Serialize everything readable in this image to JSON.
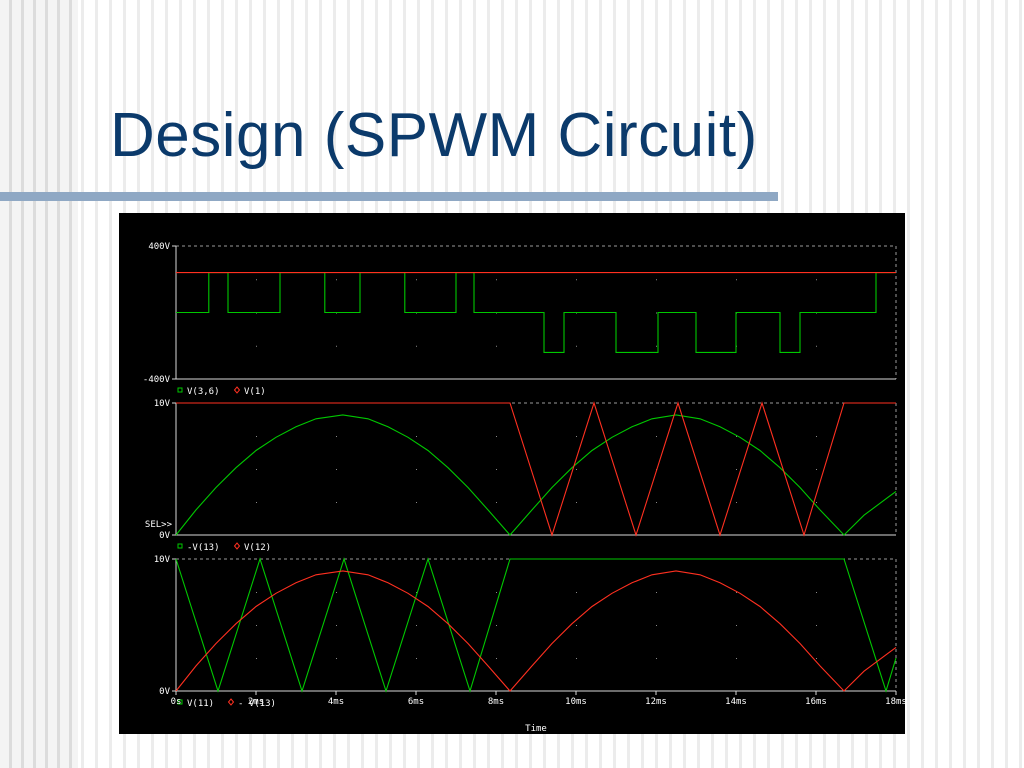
{
  "slide": {
    "title": "Design (SPWM Circuit)"
  },
  "chart_data": {
    "type": "line",
    "x_axis": {
      "label": "Time",
      "range_ms": [
        0,
        18
      ],
      "ticks": [
        "0s",
        "2ms",
        "4ms",
        "6ms",
        "8ms",
        "10ms",
        "12ms",
        "14ms",
        "16ms",
        "18ms"
      ]
    },
    "panels": [
      {
        "name": "output-voltage",
        "ylim": [
          -400,
          400
        ],
        "y_tick_labels": [
          "400V",
          "-400V"
        ],
        "legend": [
          {
            "label": "V(3,6)",
            "marker": "□",
            "color": "#00c800"
          },
          {
            "label": "V(1)",
            "marker": "◇",
            "color": "#ff3020"
          }
        ],
        "series": [
          {
            "name": "V(3,6)",
            "color": "#00c800",
            "kind": "step",
            "points": [
              [
                0,
                0
              ],
              [
                0.82,
                0
              ],
              [
                0.82,
                240
              ],
              [
                1.3,
                240
              ],
              [
                1.3,
                0
              ],
              [
                2.6,
                0
              ],
              [
                2.6,
                240
              ],
              [
                3.72,
                240
              ],
              [
                3.72,
                0
              ],
              [
                4.6,
                0
              ],
              [
                4.6,
                240
              ],
              [
                5.72,
                240
              ],
              [
                5.72,
                0
              ],
              [
                7.0,
                0
              ],
              [
                7.0,
                240
              ],
              [
                7.45,
                240
              ],
              [
                7.45,
                0
              ],
              [
                9.2,
                0
              ],
              [
                9.2,
                -240
              ],
              [
                9.7,
                -240
              ],
              [
                9.7,
                0
              ],
              [
                11.0,
                0
              ],
              [
                11.0,
                -240
              ],
              [
                12.05,
                -240
              ],
              [
                12.05,
                0
              ],
              [
                13.0,
                0
              ],
              [
                13.0,
                -240
              ],
              [
                14.0,
                -240
              ],
              [
                14.0,
                0
              ],
              [
                15.1,
                0
              ],
              [
                15.1,
                -240
              ],
              [
                15.6,
                -240
              ],
              [
                15.6,
                0
              ],
              [
                17.5,
                0
              ],
              [
                17.5,
                240
              ],
              [
                18.0,
                240
              ]
            ]
          },
          {
            "name": "V(1)",
            "color": "#ff3020",
            "kind": "line",
            "points": [
              [
                0,
                240
              ],
              [
                18,
                240
              ]
            ]
          }
        ]
      },
      {
        "name": "carrier-and-inverted-reference",
        "ylim": [
          0,
          10
        ],
        "y_tick_labels": [
          "10V",
          "0V"
        ],
        "extra_label": "SEL>>",
        "legend": [
          {
            "label": "-V(13)",
            "marker": "□",
            "color": "#00c800"
          },
          {
            "label": "V(12)",
            "marker": "◇",
            "color": "#ff3020"
          }
        ],
        "series": [
          {
            "name": "-V(13)",
            "color": "#00c800",
            "kind": "line",
            "points": [
              [
                0,
                0
              ],
              [
                0.5,
                1.9
              ],
              [
                1,
                3.6
              ],
              [
                1.5,
                5.1
              ],
              [
                2,
                6.4
              ],
              [
                2.5,
                7.4
              ],
              [
                3,
                8.2
              ],
              [
                3.5,
                8.8
              ],
              [
                4.17,
                9.1
              ],
              [
                4.8,
                8.8
              ],
              [
                5.3,
                8.2
              ],
              [
                5.8,
                7.4
              ],
              [
                6.3,
                6.4
              ],
              [
                6.8,
                5.1
              ],
              [
                7.3,
                3.6
              ],
              [
                7.8,
                1.9
              ],
              [
                8.35,
                0
              ],
              [
                8.9,
                1.9
              ],
              [
                9.4,
                3.6
              ],
              [
                9.9,
                5.1
              ],
              [
                10.4,
                6.4
              ],
              [
                10.9,
                7.4
              ],
              [
                11.4,
                8.2
              ],
              [
                11.9,
                8.8
              ],
              [
                12.5,
                9.1
              ],
              [
                13.1,
                8.8
              ],
              [
                13.6,
                8.2
              ],
              [
                14.1,
                7.4
              ],
              [
                14.6,
                6.4
              ],
              [
                15.1,
                5.1
              ],
              [
                15.6,
                3.6
              ],
              [
                16.1,
                1.9
              ],
              [
                16.7,
                0
              ],
              [
                17.2,
                1.5
              ],
              [
                18,
                3.3
              ]
            ]
          },
          {
            "name": "V(12)",
            "color": "#ff3020",
            "kind": "line",
            "points": [
              [
                0,
                10
              ],
              [
                8.35,
                10
              ],
              [
                9.4,
                0
              ],
              [
                10.45,
                10
              ],
              [
                11.5,
                0
              ],
              [
                12.55,
                10
              ],
              [
                13.6,
                0
              ],
              [
                14.65,
                10
              ],
              [
                15.7,
                0
              ],
              [
                16.7,
                10
              ],
              [
                18,
                10
              ]
            ]
          }
        ]
      },
      {
        "name": "carrier-and-reference",
        "ylim": [
          0,
          10
        ],
        "y_tick_labels": [
          "10V",
          "0V"
        ],
        "legend": [
          {
            "label": "V(11)",
            "marker": "□",
            "color": "#00c800"
          },
          {
            "label": "- V(13)",
            "marker": "◇",
            "color": "#ff3020"
          }
        ],
        "series": [
          {
            "name": "V(11)",
            "color": "#00c800",
            "kind": "line",
            "points": [
              [
                0,
                10
              ],
              [
                1.05,
                0
              ],
              [
                2.1,
                10
              ],
              [
                3.15,
                0
              ],
              [
                4.2,
                10
              ],
              [
                5.25,
                0
              ],
              [
                6.3,
                10
              ],
              [
                7.35,
                0
              ],
              [
                8.35,
                10
              ],
              [
                16.7,
                10
              ],
              [
                17.75,
                0
              ],
              [
                18,
                2.5
              ]
            ]
          },
          {
            "name": "- V(13)",
            "color": "#ff3020",
            "kind": "line",
            "points": [
              [
                0,
                0
              ],
              [
                0.5,
                1.9
              ],
              [
                1,
                3.6
              ],
              [
                1.5,
                5.1
              ],
              [
                2,
                6.4
              ],
              [
                2.5,
                7.4
              ],
              [
                3,
                8.2
              ],
              [
                3.5,
                8.8
              ],
              [
                4.17,
                9.1
              ],
              [
                4.8,
                8.8
              ],
              [
                5.3,
                8.2
              ],
              [
                5.8,
                7.4
              ],
              [
                6.3,
                6.4
              ],
              [
                6.8,
                5.1
              ],
              [
                7.3,
                3.6
              ],
              [
                7.8,
                1.9
              ],
              [
                8.35,
                0
              ],
              [
                8.9,
                1.9
              ],
              [
                9.4,
                3.6
              ],
              [
                9.9,
                5.1
              ],
              [
                10.4,
                6.4
              ],
              [
                10.9,
                7.4
              ],
              [
                11.4,
                8.2
              ],
              [
                11.9,
                8.8
              ],
              [
                12.5,
                9.1
              ],
              [
                13.1,
                8.8
              ],
              [
                13.6,
                8.2
              ],
              [
                14.1,
                7.4
              ],
              [
                14.6,
                6.4
              ],
              [
                15.1,
                5.1
              ],
              [
                15.6,
                3.6
              ],
              [
                16.1,
                1.9
              ],
              [
                16.7,
                0
              ],
              [
                17.2,
                1.5
              ],
              [
                18,
                3.3
              ]
            ]
          }
        ]
      }
    ]
  }
}
